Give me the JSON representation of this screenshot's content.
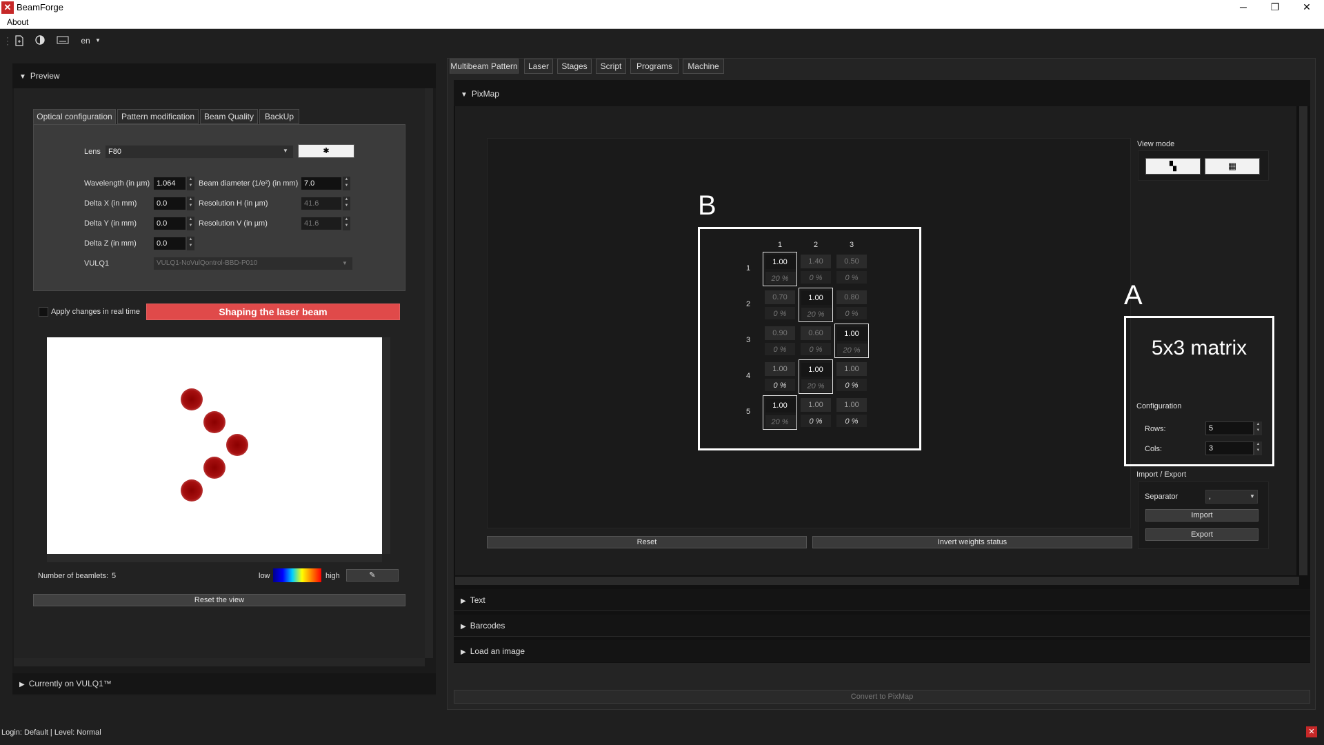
{
  "window": {
    "title": "BeamForge",
    "minimize": "─",
    "restore": "❐",
    "close": "✕"
  },
  "menu": {
    "about": "About"
  },
  "toolbar": {
    "language": "en"
  },
  "preview": {
    "header": "Preview",
    "tabs": [
      "Optical configuration",
      "Pattern modification",
      "Beam Quality",
      "BackUp"
    ],
    "lens_label": "Lens",
    "lens_value": "F80",
    "wavelength_label": "Wavelength (in µm)",
    "wavelength_value": "1.064",
    "beam_diameter_label": "Beam diameter (1/e²) (in mm)",
    "beam_diameter_value": "7.0",
    "delta_x_label": "Delta X (in mm)",
    "delta_x_value": "0.0",
    "res_h_label": "Resolution H (in µm)",
    "res_h_value": "41.6",
    "delta_y_label": "Delta Y (in mm)",
    "delta_y_value": "0.0",
    "res_v_label": "Resolution V (in µm)",
    "res_v_value": "41.6",
    "delta_z_label": "Delta Z (in mm)",
    "delta_z_value": "0.0",
    "vulq_label": "VULQ1",
    "vulq_value": "VULQ1-NoVulQontrol-BBD-P010",
    "apply_label": "Apply changes in real time",
    "shaping_button": "Shaping the laser beam",
    "beamlets_label": "Number of beamlets:",
    "beamlets_value": "5",
    "low_label": "low",
    "high_label": "high",
    "reset_view": "Reset the view",
    "currently_on": "Currently on VULQ1™"
  },
  "main": {
    "tabs": [
      "Multibeam Pattern",
      "Laser",
      "Stages",
      "Script",
      "Programs",
      "Machine"
    ],
    "pixmap_header": "PixMap",
    "annotation_a": "A",
    "annotation_b": "B",
    "matrix_caption": "5x3 matrix",
    "col_headers": [
      "1",
      "2",
      "3"
    ],
    "row_headers": [
      "1",
      "2",
      "3",
      "4",
      "5"
    ],
    "matrix": [
      [
        {
          "v": "1.00",
          "p": "20 %",
          "sel": true
        },
        {
          "v": "1.40",
          "p": "0 %"
        },
        {
          "v": "0.50",
          "p": "0 %"
        }
      ],
      [
        {
          "v": "0.70",
          "p": "0 %"
        },
        {
          "v": "1.00",
          "p": "20 %",
          "sel": true
        },
        {
          "v": "0.80",
          "p": "0 %"
        }
      ],
      [
        {
          "v": "0.90",
          "p": "0 %"
        },
        {
          "v": "0.60",
          "p": "0 %"
        },
        {
          "v": "1.00",
          "p": "20 %",
          "sel": true
        }
      ],
      [
        {
          "v": "1.00",
          "p": "0 %",
          "bright": true
        },
        {
          "v": "1.00",
          "p": "20 %",
          "sel": true
        },
        {
          "v": "1.00",
          "p": "0 %",
          "bright": true
        }
      ],
      [
        {
          "v": "1.00",
          "p": "20 %",
          "sel": true
        },
        {
          "v": "1.00",
          "p": "0 %",
          "bright": true
        },
        {
          "v": "1.00",
          "p": "0 %",
          "bright": true
        }
      ]
    ],
    "view_mode_label": "View mode",
    "configuration_label": "Configuration",
    "rows_label": "Rows:",
    "rows_value": "5",
    "cols_label": "Cols:",
    "cols_value": "3",
    "import_export_label": "Import / Export",
    "separator_label": "Separator",
    "separator_value": ",",
    "import_button": "Import",
    "export_button": "Export",
    "reset_button": "Reset",
    "invert_button": "Invert weights status",
    "text_section": "Text",
    "barcodes_section": "Barcodes",
    "load_image_section": "Load an image",
    "convert_button": "Convert to PixMap"
  },
  "status": {
    "login": "Login: Default | Level: Normal"
  },
  "colors": {
    "accent_red": "#e04a4a",
    "background": "#1f1f1f"
  }
}
